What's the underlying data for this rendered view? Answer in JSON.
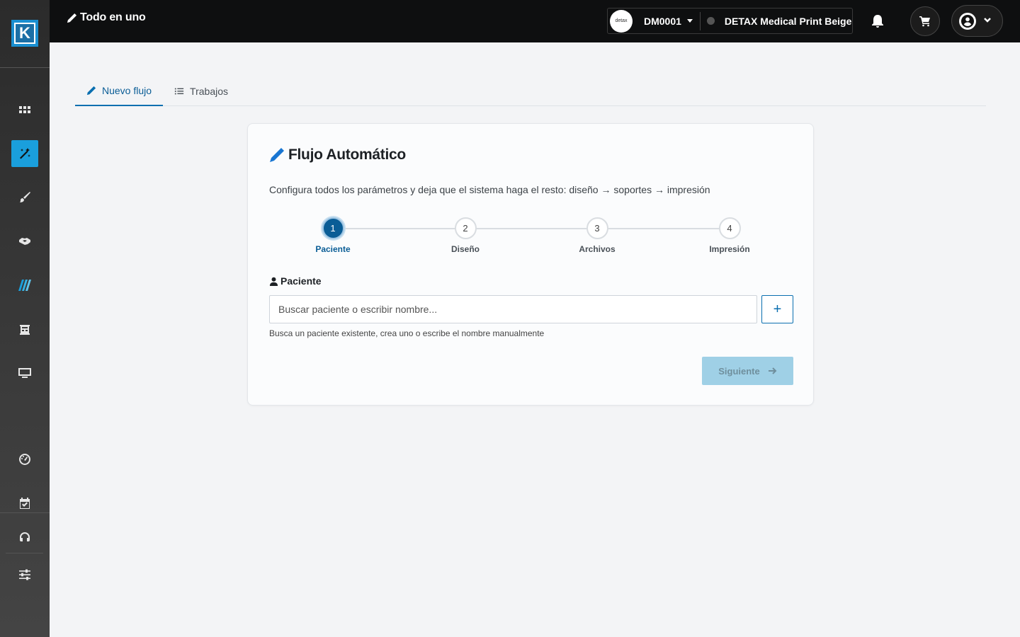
{
  "app": {
    "logo_letter": "K",
    "title": "Todo en uno"
  },
  "sidebar": {
    "items": [
      {
        "name": "apps",
        "icon": "grid-icon",
        "active": false
      },
      {
        "name": "magic",
        "icon": "magic-wand-icon",
        "active": true
      },
      {
        "name": "brush",
        "icon": "paint-brush-icon",
        "active": false
      },
      {
        "name": "handshake",
        "icon": "handshake-icon",
        "active": false
      },
      {
        "name": "slashes",
        "icon": "slashes-icon",
        "active": false
      },
      {
        "name": "calc",
        "icon": "printer-tray-icon",
        "active": false
      },
      {
        "name": "monitor",
        "icon": "monitor-icon",
        "active": false
      },
      {
        "name": "gauge",
        "icon": "gauge-icon",
        "active": false
      },
      {
        "name": "calendar",
        "icon": "calendar-check-icon",
        "active": false
      },
      {
        "name": "support",
        "icon": "headset-icon",
        "active": false
      },
      {
        "name": "settings",
        "icon": "sliders-icon",
        "active": false
      }
    ],
    "active_color": "#1a9fdc"
  },
  "topbar": {
    "device_logo_text": "detax",
    "device_id": "DM0001",
    "device_name": "DETAX Medical Print Beige",
    "device_status_color": "#555555"
  },
  "tabs": [
    {
      "label": "Nuevo flujo",
      "icon": "pencil-icon",
      "active": true
    },
    {
      "label": "Trabajos",
      "icon": "list-icon",
      "active": false
    }
  ],
  "card": {
    "title": "Flujo Automático",
    "description": "Configura todos los parámetros y deja que el sistema haga el resto: diseño → soportes → impresión",
    "steps": [
      {
        "number": "1",
        "label": "Paciente",
        "active": true
      },
      {
        "number": "2",
        "label": "Diseño",
        "active": false
      },
      {
        "number": "3",
        "label": "Archivos",
        "active": false
      },
      {
        "number": "4",
        "label": "Impresión",
        "active": false
      }
    ],
    "patient_label": "Paciente",
    "search_placeholder": "Buscar paciente o escribir nombre...",
    "search_value": "",
    "add_button": "+",
    "help_text": "Busca un paciente existente, crea uno o escribe el nombre manualmente",
    "next_button": "Siguiente"
  },
  "colors": {
    "primary": "#0a5d96",
    "accent": "#1976d2",
    "disabled_button": "#9fd0e6"
  }
}
